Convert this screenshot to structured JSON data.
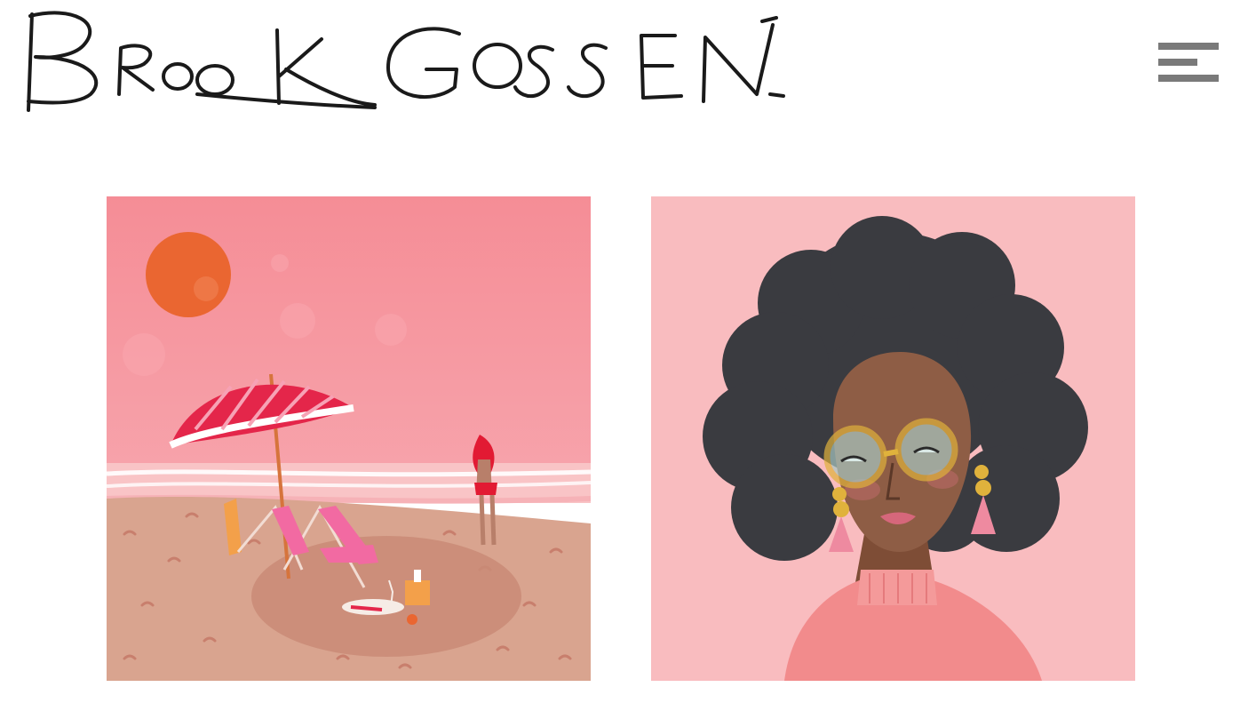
{
  "site": {
    "logo_text": "BROOK GOSSEN"
  },
  "header": {
    "menu_icon": "hamburger-menu-icon"
  },
  "gallery": {
    "items": [
      {
        "subject": "beach-umbrella-illustration"
      },
      {
        "subject": "woman-portrait-illustration"
      }
    ]
  },
  "colors": {
    "background": "#ffffff",
    "logo_ink": "#1a1a1a",
    "menu_icon": "#7a7a7a",
    "beach_sky": "#f6919b",
    "beach_sand": "#d9a48f",
    "beach_sun": "#ea6631",
    "portrait_bg": "#f9bcbf",
    "portrait_hair": "#3a3b40",
    "portrait_skin": "#8e5d45",
    "portrait_sweater": "#f28b8c",
    "glasses": "#e0b23c"
  }
}
